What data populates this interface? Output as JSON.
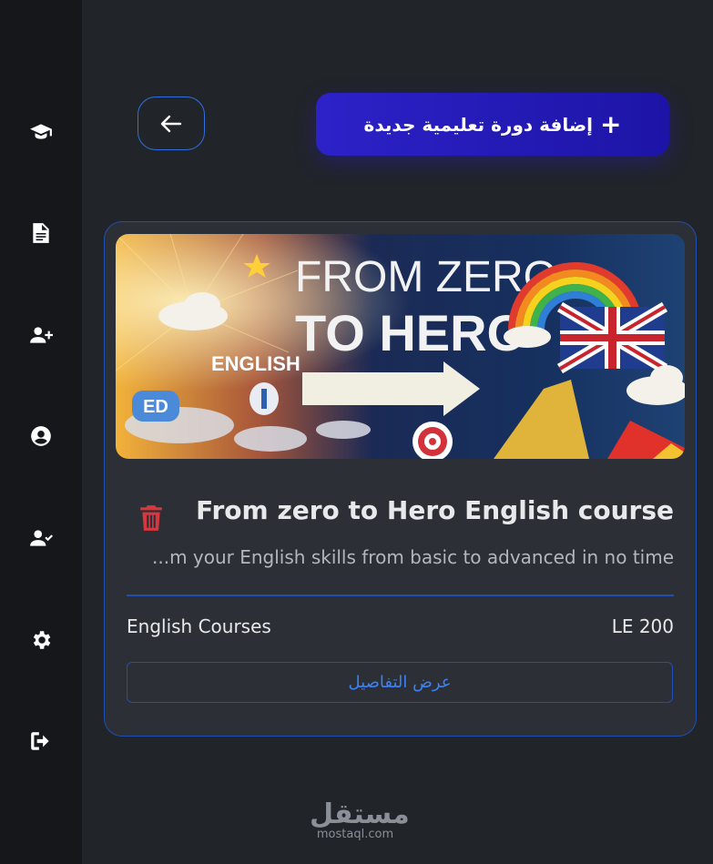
{
  "sidebar": {
    "items": [
      {
        "icon": "graduation-cap-icon"
      },
      {
        "icon": "document-icon"
      },
      {
        "icon": "user-plus-icon"
      },
      {
        "icon": "user-circle-icon"
      },
      {
        "icon": "user-check-icon"
      },
      {
        "icon": "gear-icon"
      },
      {
        "icon": "logout-icon"
      }
    ]
  },
  "header": {
    "back_icon": "arrow-left-icon",
    "add_course_label": "إضافة دورة تعليمية جديدة",
    "add_icon": "+"
  },
  "course": {
    "banner": {
      "line1": "FROM ZERO",
      "line2": "TO HERO",
      "tag": "ENGLISH",
      "badge": "ED"
    },
    "title": "From zero to Hero English course",
    "description": "...m your English skills from basic to advanced in no time",
    "category": "English Courses",
    "price": "LE 200",
    "details_label": "عرض التفاصيل"
  },
  "watermark": {
    "arabic": "مستقل",
    "latin": "mostaql.com"
  },
  "colors": {
    "background": "#212429",
    "sidebar": "#16171b",
    "card": "#2c3036",
    "accent_blue": "#1f4fb3",
    "button_gradient": "#2c22c8",
    "danger": "#d9363e"
  }
}
